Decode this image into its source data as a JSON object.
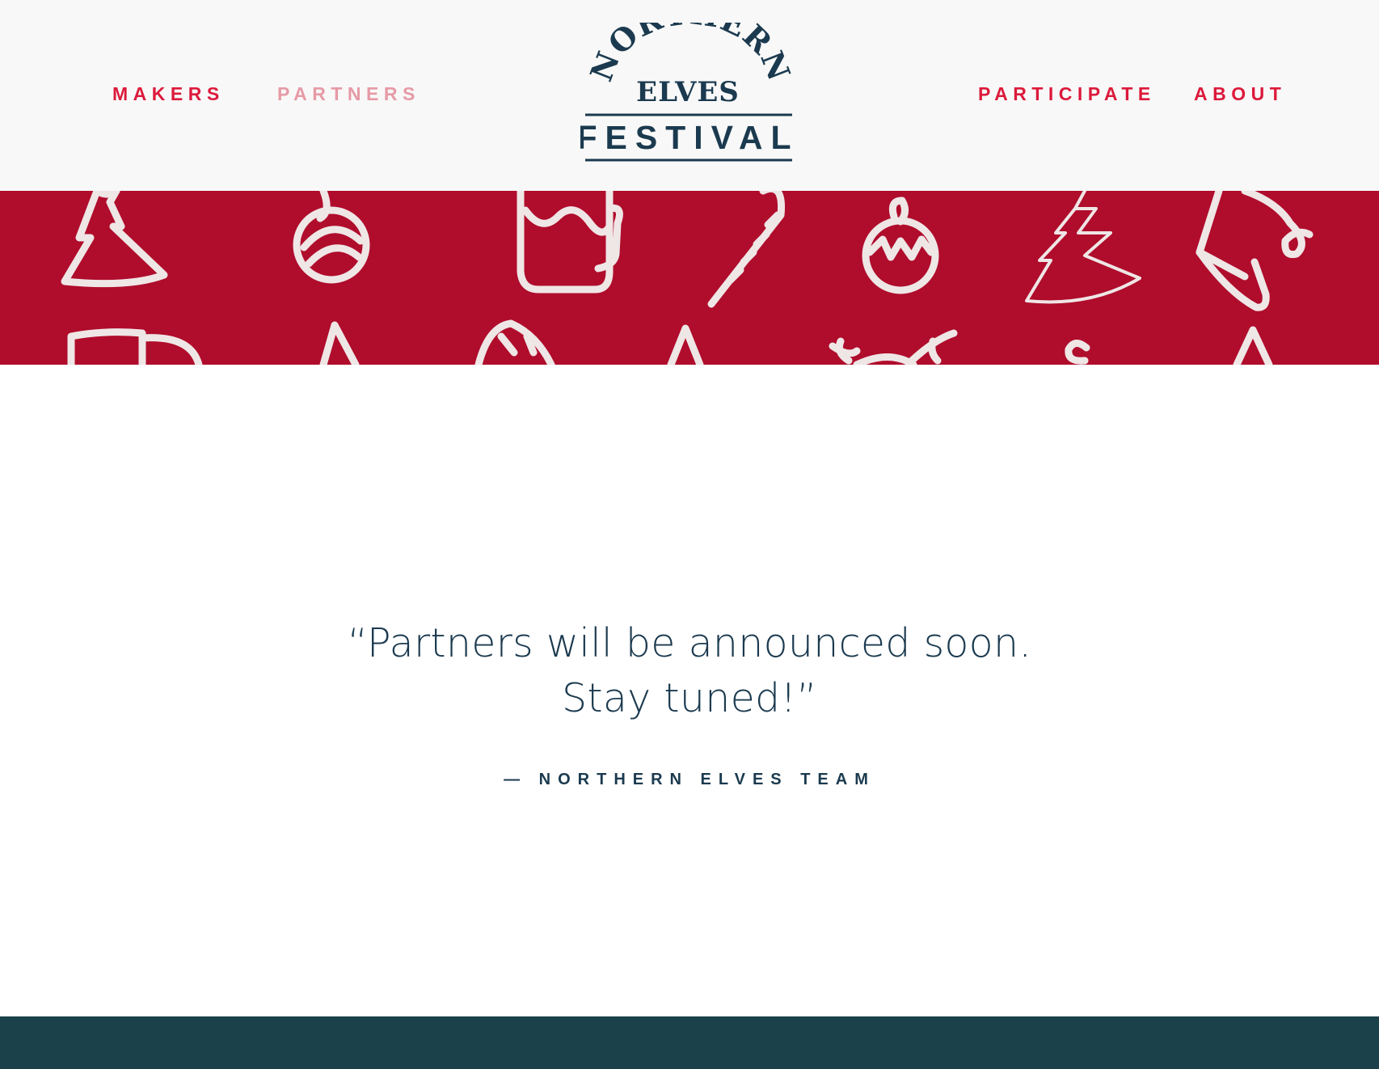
{
  "nav": {
    "left": [
      {
        "label": "MAKERS",
        "active": false
      },
      {
        "label": "PARTNERS",
        "active": true
      }
    ],
    "right": [
      {
        "label": "PARTICIPATE",
        "active": false
      },
      {
        "label": "ABOUT",
        "active": false
      }
    ]
  },
  "logo": {
    "arc_text": "NORTHERN",
    "middle_text": "ELVES",
    "bottom_text": "FESTIVAL"
  },
  "quote": {
    "line1": "“Partners will be announced soon.",
    "line2": "Stay tuned!”",
    "attribution": "— NORTHERN ELVES TEAM"
  },
  "colors": {
    "header_bg": "#f8f8f8",
    "nav_link": "#dc1a3b",
    "nav_link_active": "#e69aa5",
    "banner_red": "#b00c2c",
    "pattern_line": "#efe6e6",
    "text_navy": "#1b3a4f",
    "footer_teal": "#1b414a"
  },
  "banner": {
    "pattern_icons": [
      "tree-icon",
      "ornament-icon",
      "mug-icon",
      "candy-cane-icon",
      "ornament-icon",
      "tree-icon",
      "elf-hat-icon",
      "mug-icon",
      "tree-icon",
      "leaf-icon",
      "tree-icon",
      "reindeer-icon",
      "ornament-icon",
      "tree-icon"
    ]
  }
}
